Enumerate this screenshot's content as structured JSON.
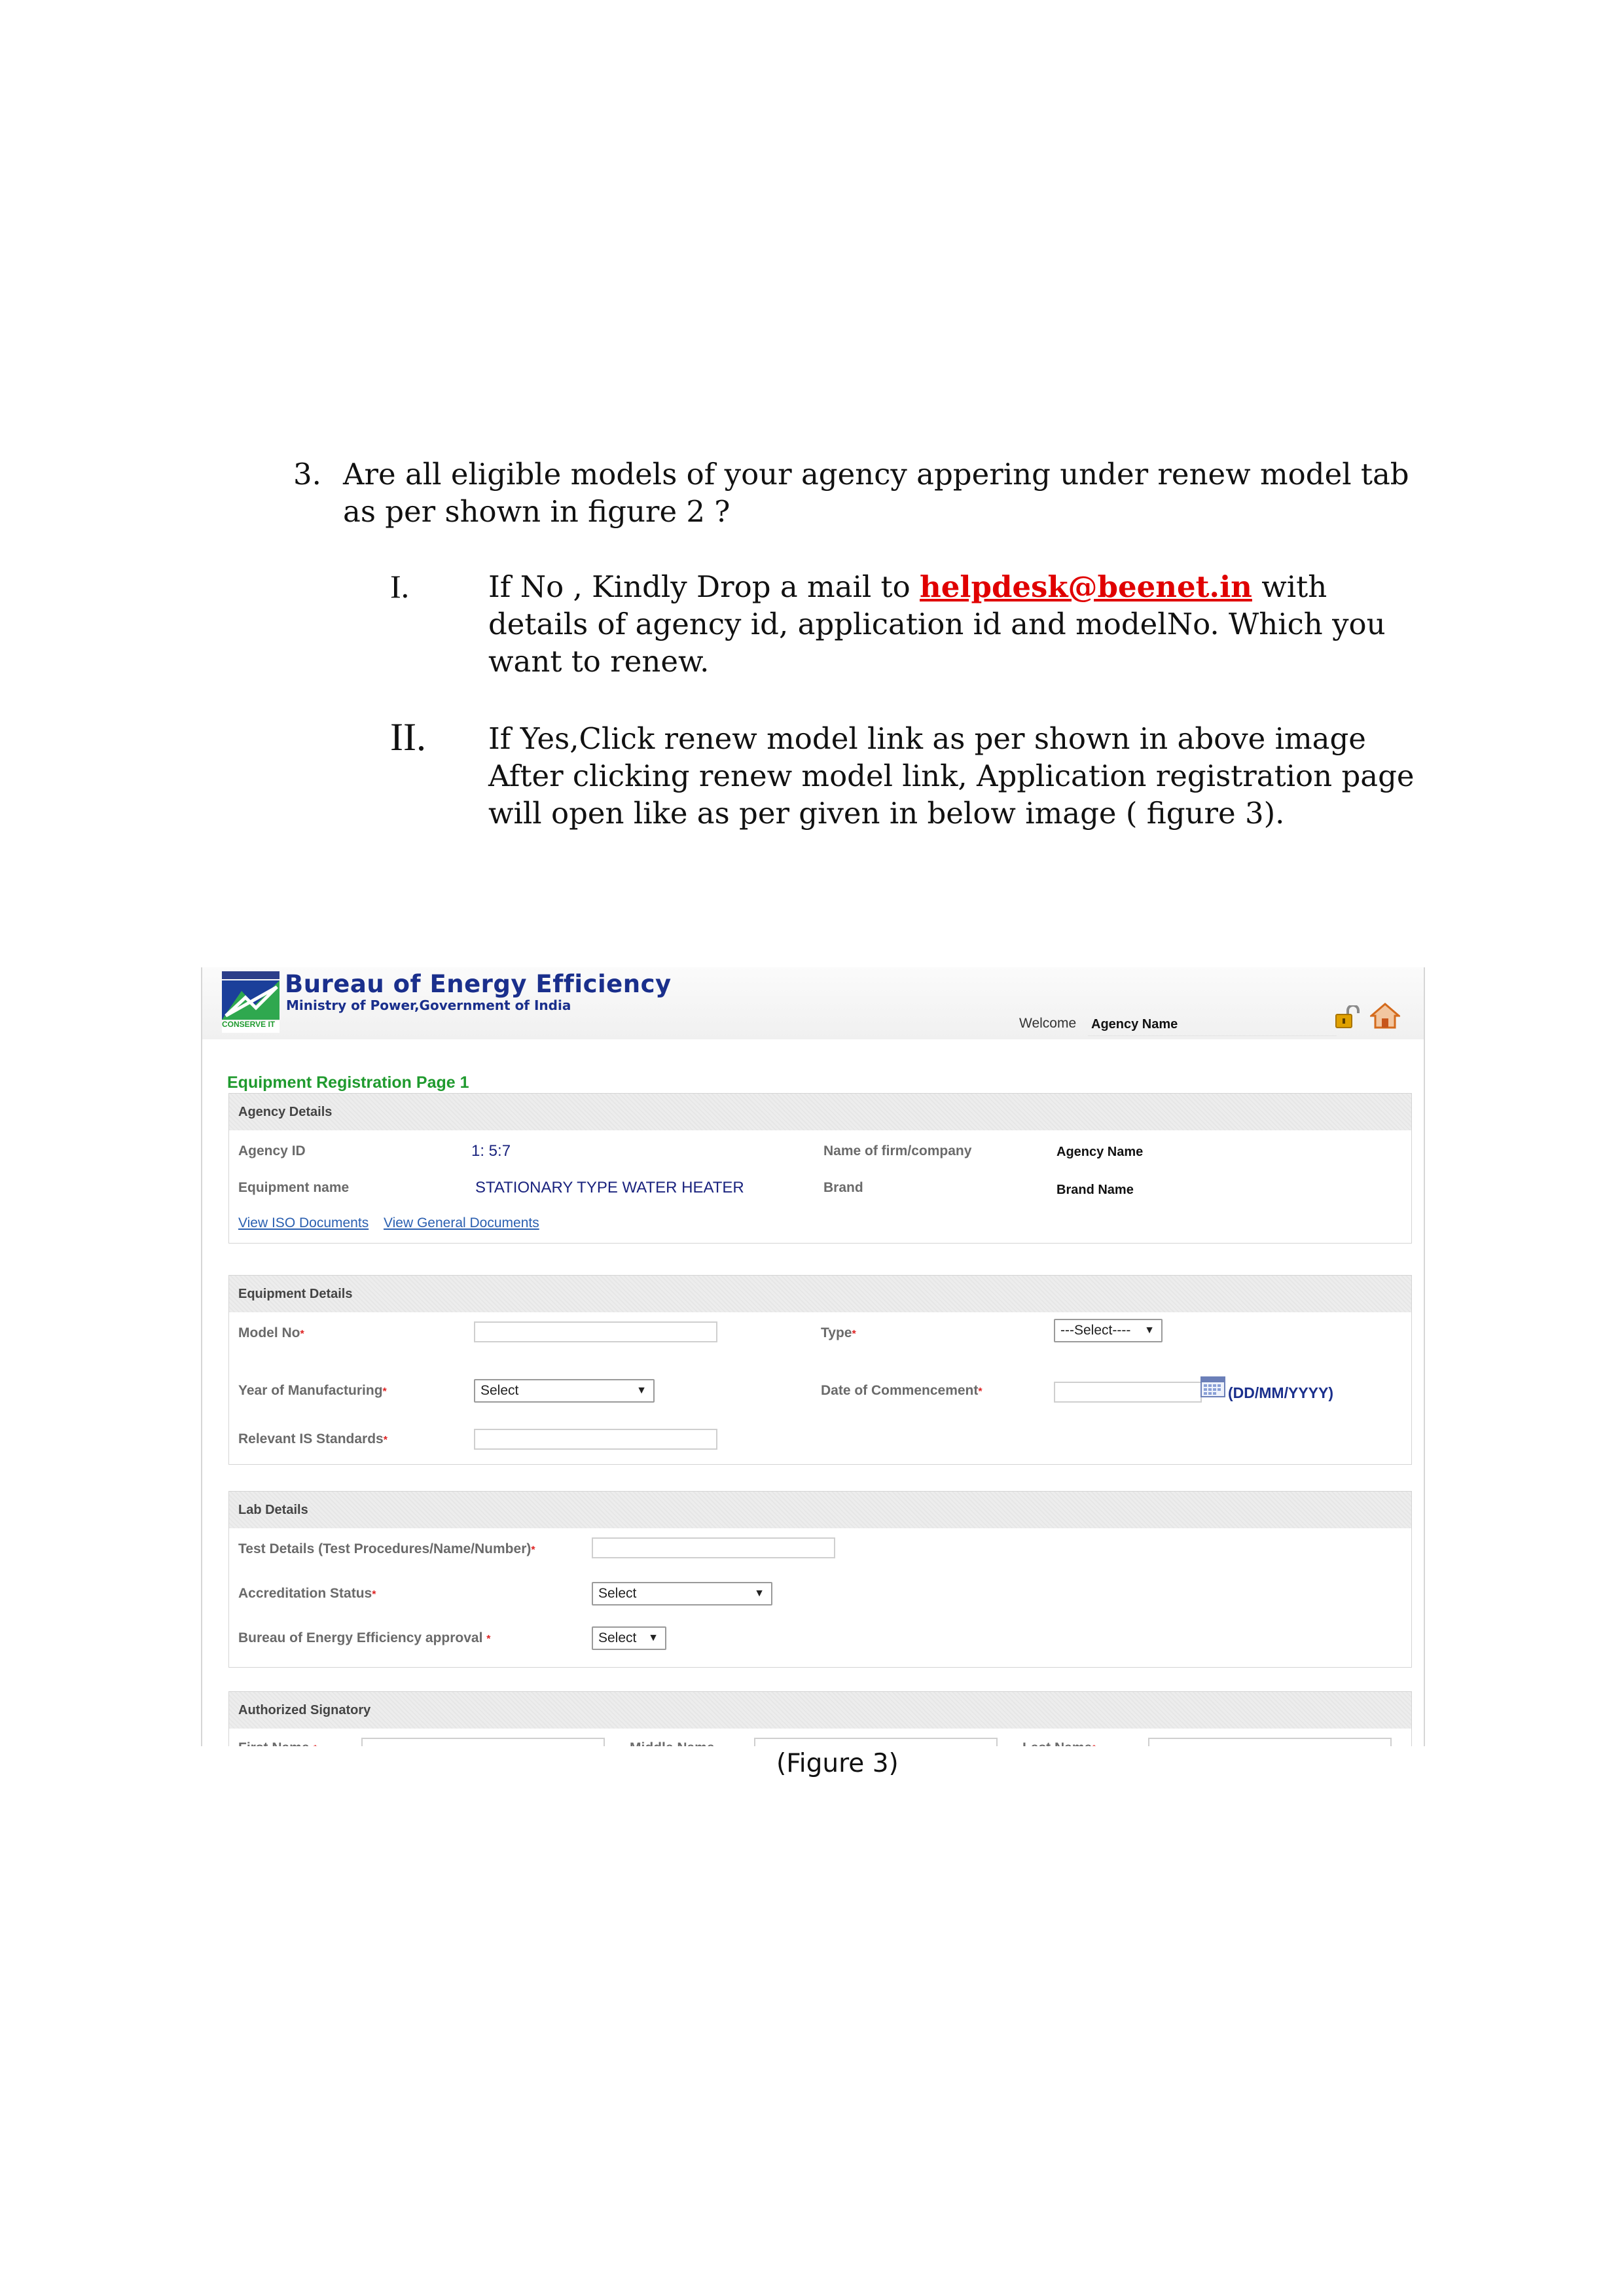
{
  "question": {
    "number": "3.",
    "text": "Are all eligible models of your agency  appering under renew model tab as per shown in figure 2 ?"
  },
  "options": [
    {
      "numeral": "I.",
      "text_before": "If  No , Kindly Drop a mail to ",
      "email": "helpdesk@beenet.in",
      "text_after": " with details of  agency id, application id and modelNo. Which you want to renew."
    },
    {
      "numeral": "II.",
      "text": "If Yes,Click renew model link as per shown in above image After clicking renew model link, Application registration page will open like as per given in below image ( figure 3)."
    }
  ],
  "screenshot": {
    "header": {
      "org_name": "Bureau of Energy Efficiency",
      "org_sub": "Ministry of Power,Government of India",
      "logo_text": "CONSERVE IT",
      "welcome_label": "Welcome",
      "welcome_user": "Agency Name"
    },
    "page_title": "Equipment Registration Page 1",
    "agency_details": {
      "heading": "Agency Details",
      "agency_id_label": "Agency ID",
      "agency_id_value": "1: 5:7",
      "firm_label": "Name of firm/company",
      "firm_value": "Agency Name",
      "equipment_label": "Equipment name",
      "equipment_value": "STATIONARY TYPE WATER HEATER",
      "brand_label": "Brand",
      "brand_value": "Brand Name",
      "link_iso": "View ISO Documents",
      "link_general": "View General Documents"
    },
    "equipment_details": {
      "heading": "Equipment Details",
      "model_label": "Model No",
      "type_label": "Type",
      "type_select": "---Select----",
      "year_label": "Year of Manufacturing",
      "year_select": "Select",
      "date_label": "Date of Commencement",
      "date_format": "(DD/MM/YYYY)",
      "standards_label": "Relevant IS Standards",
      "required_mark": "*"
    },
    "lab_details": {
      "heading": "Lab Details",
      "test_label": "Test Details (Test Procedures/Name/Number)",
      "accreditation_label": "Accreditation Status",
      "accreditation_select": "Select",
      "approval_label": "Bureau of Energy Efficiency approval ",
      "approval_select": "Select"
    },
    "authorized_signatory": {
      "heading": "Authorized Signatory",
      "first_name_label": "First Name ",
      "middle_name_label": "Middle Name",
      "last_name_label": "Last Name"
    }
  },
  "caption": "(Figure 3)",
  "colors": {
    "email": "#e00000",
    "page_title": "#1f9a2e",
    "brand_blue": "#1a2f8c",
    "link": "#2a5fb0"
  }
}
